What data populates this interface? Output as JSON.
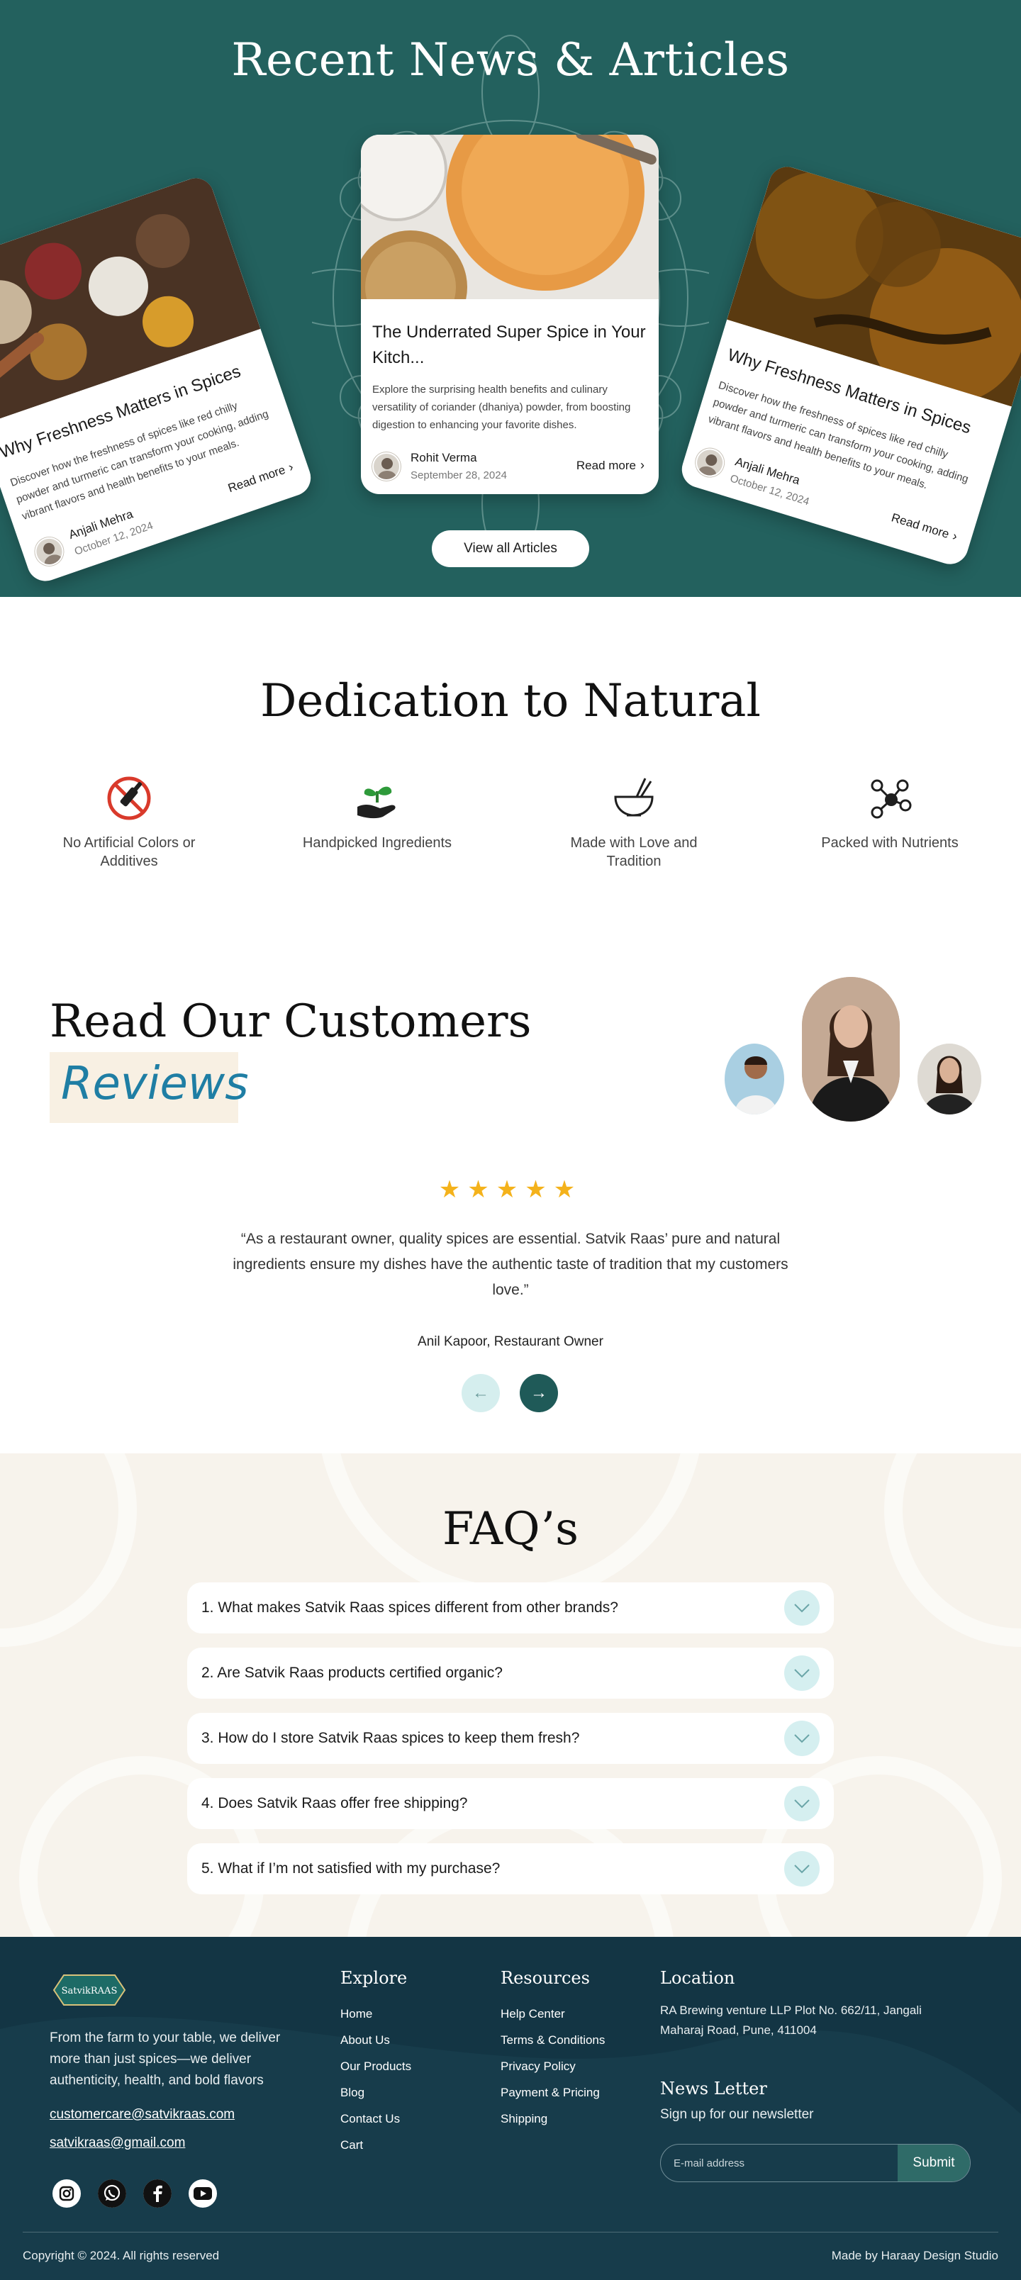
{
  "news": {
    "title": "Recent News & Articles",
    "view_all_label": "View all Articles",
    "read_more": "Read more",
    "articles": [
      {
        "title": "Why Freshness Matters in Spices",
        "excerpt": "Discover how the freshness of spices like red chilly powder and turmeric can transform your cooking, adding vibrant flavors and health benefits to your meals.",
        "author": "Anjali Mehra",
        "date": "October 12, 2024"
      },
      {
        "title": "The Underrated Super Spice in Your Kitch...",
        "excerpt": "Explore the surprising health benefits and culinary versatility of coriander (dhaniya) powder, from boosting digestion to enhancing your favorite dishes.",
        "author": "Rohit Verma",
        "date": "September 28, 2024"
      },
      {
        "title": "Why Freshness Matters in Spices",
        "excerpt": "Discover how the freshness of spices like red chilly powder and turmeric can transform your cooking, adding vibrant flavors and health benefits to your meals.",
        "author": "Anjali Mehra",
        "date": "October 12, 2024"
      }
    ]
  },
  "dedication": {
    "title": "Dedication to Natural",
    "features": [
      {
        "label": "No Artificial Colors or Additives",
        "icon": "no-artificial-icon"
      },
      {
        "label": "Handpicked Ingredients",
        "icon": "handpicked-icon"
      },
      {
        "label": "Made with Love and Tradition",
        "icon": "bowl-icon"
      },
      {
        "label": "Packed with Nutrients",
        "icon": "molecule-icon"
      }
    ]
  },
  "reviews": {
    "title": "Read Our Customers",
    "highlight": "Reviews",
    "stars": "★★★★★",
    "rating": 5,
    "quote": "“As a restaurant owner, quality spices are essential. Satvik Raas’ pure and natural ingredients ensure my dishes have the authentic taste of tradition that my customers love.”",
    "reviewer": "Anil Kapoor, Restaurant Owner",
    "prev_icon": "arrow-left-icon",
    "next_icon": "arrow-right-icon"
  },
  "faq": {
    "title": "FAQ’s",
    "items": [
      "1. What makes Satvik Raas spices different from other brands?",
      "2. Are Satvik Raas products certified organic?",
      "3. How do I store Satvik Raas spices to keep them fresh?",
      "4. Does Satvik Raas offer free shipping?",
      "5. What if I’m not satisfied with my purchase?"
    ]
  },
  "footer": {
    "logo_text": "SatvikRAAS",
    "about": "From the farm to your table, we deliver more than just spices—we deliver authenticity, health, and bold flavors",
    "emails": [
      "customercare@satvikraas.com",
      "satvikraas@gmail.com"
    ],
    "social": [
      "instagram-icon",
      "whatsapp-icon",
      "facebook-icon",
      "youtube-icon"
    ],
    "explore": {
      "title": "Explore",
      "links": [
        "Home",
        "About Us",
        "Our Products",
        "Blog",
        "Contact Us",
        "Cart"
      ]
    },
    "resources": {
      "title": "Resources",
      "links": [
        "Help Center",
        "Terms & Conditions",
        "Privacy Policy",
        "Payment & Pricing",
        "Shipping"
      ]
    },
    "location": {
      "title": "Location",
      "text": "RA Brewing venture LLP Plot No. 662/11, Jangali Maharaj Road, Pune, 411004"
    },
    "newsletter": {
      "title": "News Letter",
      "subtitle": "Sign up for our newsletter",
      "placeholder": "E-mail address",
      "submit": "Submit"
    },
    "copyright": "Copyright © 2024. All rights reserved",
    "credit": "Made by Haraay Design Studio"
  },
  "colors": {
    "teal": "#23615e",
    "footer": "#133544",
    "accent_blue": "#1f7ea4",
    "star": "#f4b21b",
    "faq_bg": "#f7f3ec"
  }
}
